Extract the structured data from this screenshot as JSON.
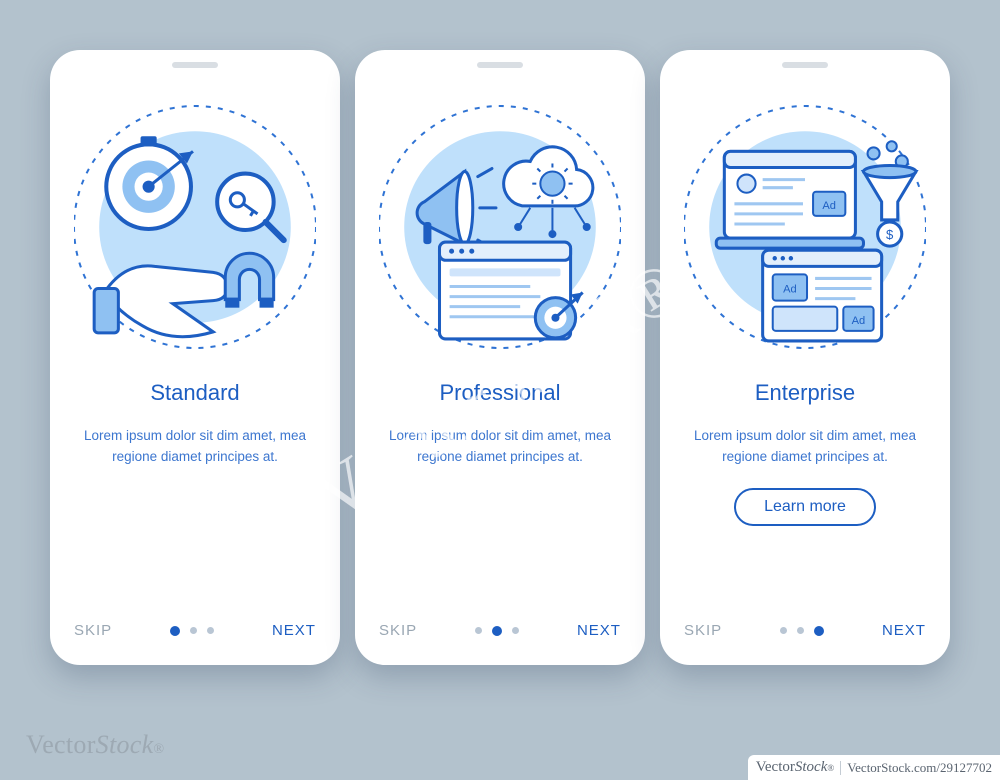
{
  "colors": {
    "primary": "#1d5ec2",
    "lightPrimary": "#8fc1f2",
    "muted": "#9aa7b3"
  },
  "screens": [
    {
      "id": "standard",
      "illustration": "target-magnet",
      "title": "Standard",
      "description": "Lorem ipsum dolor sit dim amet, mea regione diamet principes at.",
      "learn_more": null,
      "active_dot": 0,
      "skip_label": "SKIP",
      "next_label": "NEXT"
    },
    {
      "id": "professional",
      "illustration": "megaphone-browser",
      "title": "Professional",
      "description": "Lorem ipsum dolor sit dim amet, mea regione diamet principes at.",
      "learn_more": null,
      "active_dot": 1,
      "skip_label": "SKIP",
      "next_label": "NEXT"
    },
    {
      "id": "enterprise",
      "illustration": "ads-funnel",
      "title": "Enterprise",
      "description": "Lorem ipsum dolor sit dim amet, mea regione diamet principes at.",
      "learn_more": "Learn more",
      "active_dot": 2,
      "skip_label": "SKIP",
      "next_label": "NEXT"
    }
  ],
  "dot_count": 3,
  "watermark": {
    "brand_v": "Vector",
    "brand_s": "Stock",
    "brand_full": "VectorStock",
    "url": "VectorStock.com/29127702"
  }
}
